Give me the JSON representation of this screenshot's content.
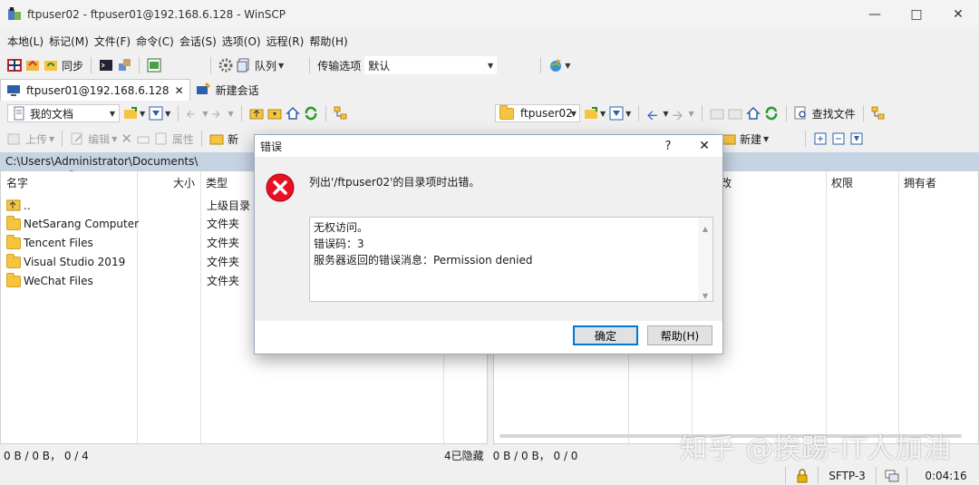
{
  "window": {
    "title": "ftpuser02 - ftpuser01@192.168.6.128 - WinSCP"
  },
  "menu": [
    "本地(L)",
    "标记(M)",
    "文件(F)",
    "命令(C)",
    "会话(S)",
    "选项(O)",
    "远程(R)",
    "帮助(H)"
  ],
  "toolbar": {
    "sync": "同步",
    "queue": "队列",
    "transfer_label": "传输选项",
    "transfer_value": "默认"
  },
  "tabs": {
    "session": "ftpuser01@192.168.6.128",
    "new_session": "新建会话"
  },
  "local": {
    "location": "我的文档",
    "upload": "上传",
    "edit": "编辑",
    "properties": "属性",
    "new": "新",
    "path": "C:\\Users\\Administrator\\Documents\\",
    "columns": {
      "name": "名字",
      "size": "大小",
      "type": "类型"
    },
    "files": [
      {
        "name": "..",
        "type": "上级目录",
        "icon": "parent-dir-icon"
      },
      {
        "name": "NetSarang Computer",
        "type": "文件夹",
        "icon": "folder-icon"
      },
      {
        "name": "Tencent Files",
        "type": "文件夹",
        "icon": "folder-icon"
      },
      {
        "name": "Visual Studio 2019",
        "type": "文件夹",
        "icon": "folder-icon"
      },
      {
        "name": "WeChat Files",
        "type": "文件夹",
        "icon": "folder-icon"
      }
    ],
    "status": "0 B / 0 B， 0 / 4",
    "hidden": "4已隐藏"
  },
  "remote": {
    "location": "ftpuser02",
    "find_files": "查找文件",
    "new": "新建",
    "columns": {
      "changed": "改",
      "rights": "权限",
      "owner": "拥有者"
    },
    "status": "0 B / 0 B， 0 / 0"
  },
  "statusbar": {
    "protocol": "SFTP-3",
    "time": "0:04:16"
  },
  "dialog": {
    "title": "错误",
    "help_q": "?",
    "message": "列出'/ftpuser02'的目录项时出错。",
    "details": [
      "无权访问。",
      "错误码：3",
      "服务器返回的错误消息：Permission denied"
    ],
    "ok": "确定",
    "help": "帮助(H)"
  },
  "watermark": "知乎 @挨踢-IT人加油",
  "colors": {
    "accent": "#0078d7",
    "error": "#e81123",
    "pathbar": "#c6d3e3"
  }
}
